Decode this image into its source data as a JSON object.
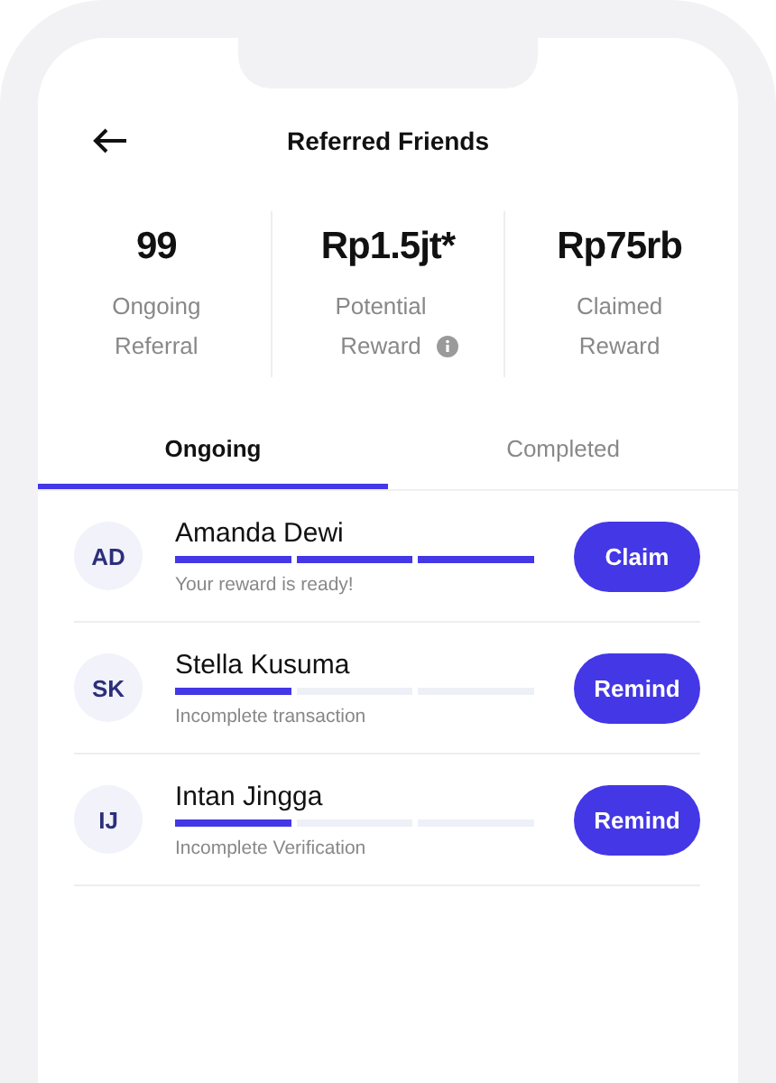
{
  "header": {
    "title": "Referred Friends"
  },
  "stats": [
    {
      "value": "99",
      "label": "Ongoing Referral",
      "info": false
    },
    {
      "value": "Rp1.5jt*",
      "label": "Potential Reward",
      "info": true
    },
    {
      "value": "Rp75rb",
      "label": "Claimed Reward",
      "info": false
    }
  ],
  "tabs": [
    {
      "label": "Ongoing",
      "selected": true
    },
    {
      "label": "Completed",
      "selected": false
    }
  ],
  "friends": [
    {
      "initials": "AD",
      "name": "Amanda Dewi",
      "level": 1,
      "status": "Your reward is ready!",
      "action": "Claim"
    },
    {
      "initials": "SK",
      "name": "Stella Kusuma",
      "level": 0.33,
      "status": "Incomplete transaction",
      "action": "Remind"
    },
    {
      "initials": "IJ",
      "name": "Intan Jingga",
      "level": 0.33,
      "status": "Incomplete Verification",
      "action": "Remind"
    }
  ]
}
